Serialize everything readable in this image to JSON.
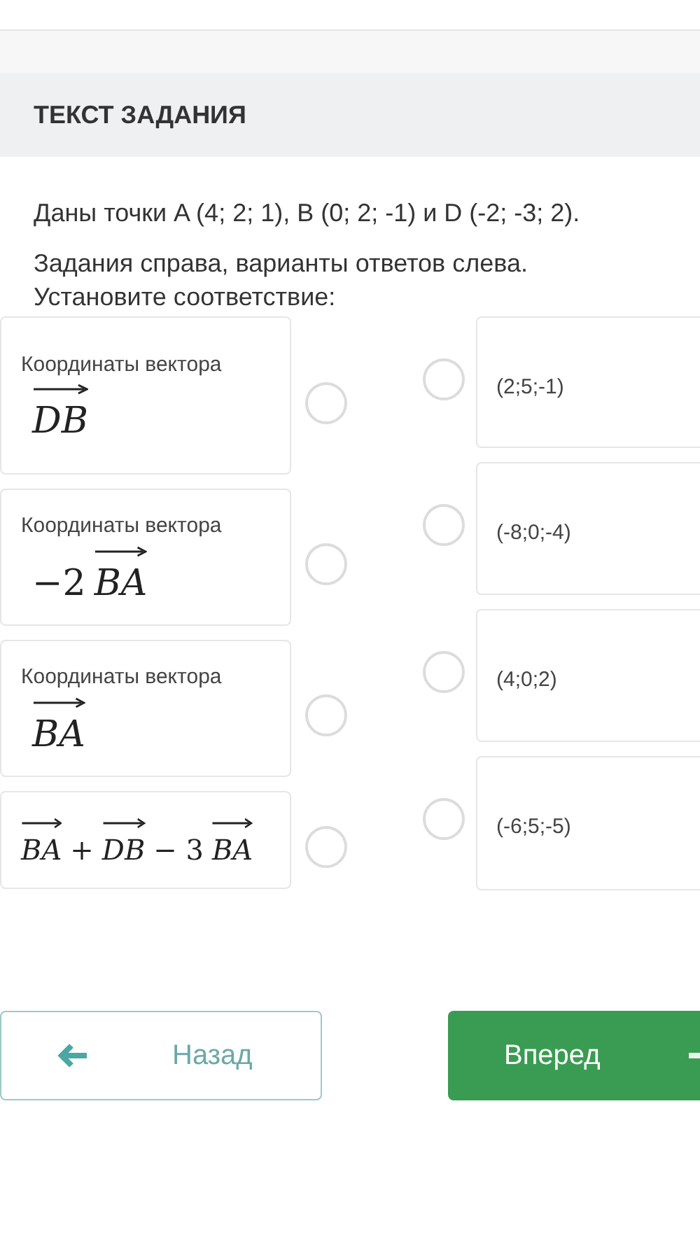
{
  "section_title": "ТЕКСТ ЗАДАНИЯ",
  "task_text": "Даны точки A (4; 2; 1), B (0; 2; -1) и D (-2; -3; 2).",
  "instruction": "Задания справа, варианты ответов слева. Установите соответствие:",
  "left_items": [
    {
      "label": "Координаты вектора",
      "formula": [
        {
          "kind": "vector",
          "text": "DB"
        }
      ],
      "selected": false
    },
    {
      "label": "Координаты вектора",
      "formula": [
        {
          "kind": "plain",
          "text": "−2"
        },
        {
          "kind": "vector",
          "text": "BA"
        }
      ],
      "selected": false
    },
    {
      "label": "Координаты вектора",
      "formula": [
        {
          "kind": "vector",
          "text": "BA"
        }
      ],
      "selected": false
    },
    {
      "formula": [
        {
          "kind": "vector",
          "text": "BA"
        },
        {
          "kind": "plain",
          "text": "+"
        },
        {
          "kind": "vector",
          "text": "DB"
        },
        {
          "kind": "plain",
          "text": "− 3"
        },
        {
          "kind": "vector",
          "text": "BA"
        }
      ],
      "selected": false
    }
  ],
  "right_items": [
    {
      "text": "(2;5;-1)",
      "selected": false
    },
    {
      "text": "(-8;0;-4)",
      "selected": false
    },
    {
      "text": "(4;0;2)",
      "selected": false
    },
    {
      "text": "(-6;5;-5)",
      "selected": false
    }
  ],
  "buttons": [
    {
      "kind": "back",
      "label": "Назад"
    },
    {
      "kind": "next",
      "label": "Вперед"
    }
  ]
}
